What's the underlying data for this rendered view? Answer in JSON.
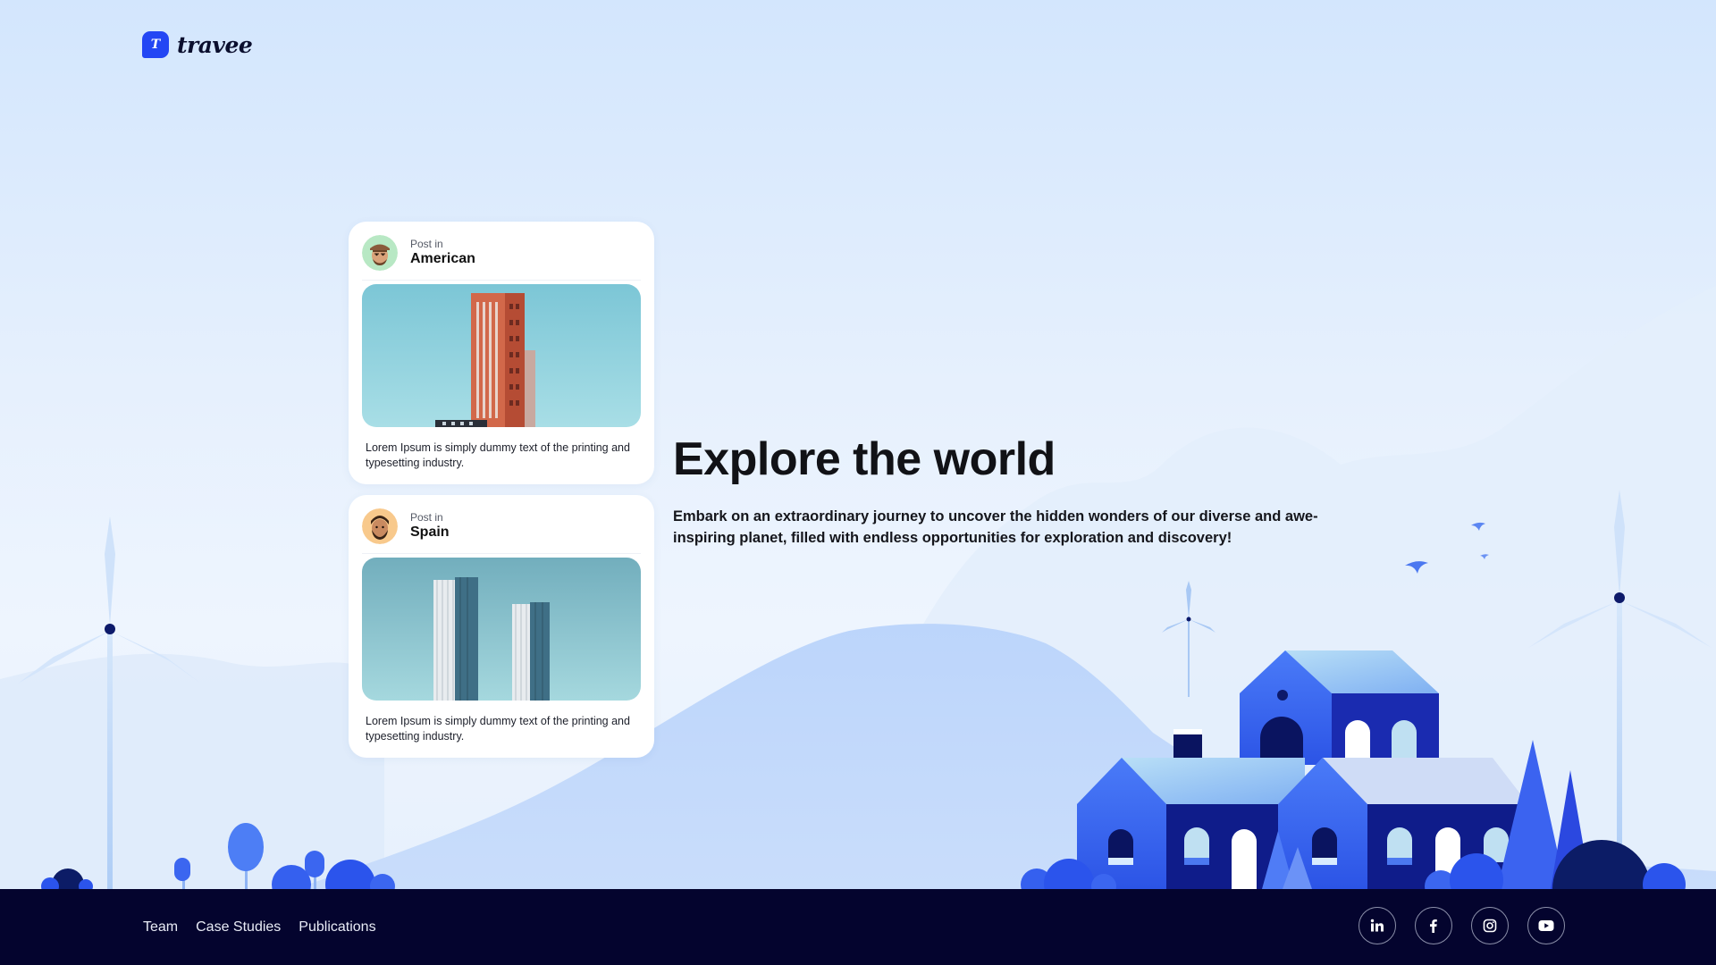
{
  "brand": {
    "logo_letter": "T",
    "name": "travee",
    "accent_color": "#2346f4",
    "footer_color": "#04042e"
  },
  "posts": [
    {
      "post_in_label": "Post in",
      "location": "American",
      "description": "Lorem Ipsum is simply dummy text of the printing and typesetting industry.",
      "image": "red-tower-building"
    },
    {
      "post_in_label": "Post in",
      "location": "Spain",
      "description": "Lorem Ipsum is simply dummy text of the printing and typesetting industry.",
      "image": "twin-towers-building"
    }
  ],
  "hero": {
    "title": "Explore the world",
    "description": "Embark on an extraordinary journey to uncover the hidden wonders of our diverse and awe-inspiring planet, filled with endless opportunities for exploration and discovery!"
  },
  "footer": {
    "links": [
      "Team",
      "Case Studies",
      "Publications"
    ],
    "social": [
      "linkedin-icon",
      "facebook-icon",
      "instagram-icon",
      "youtube-icon"
    ]
  }
}
